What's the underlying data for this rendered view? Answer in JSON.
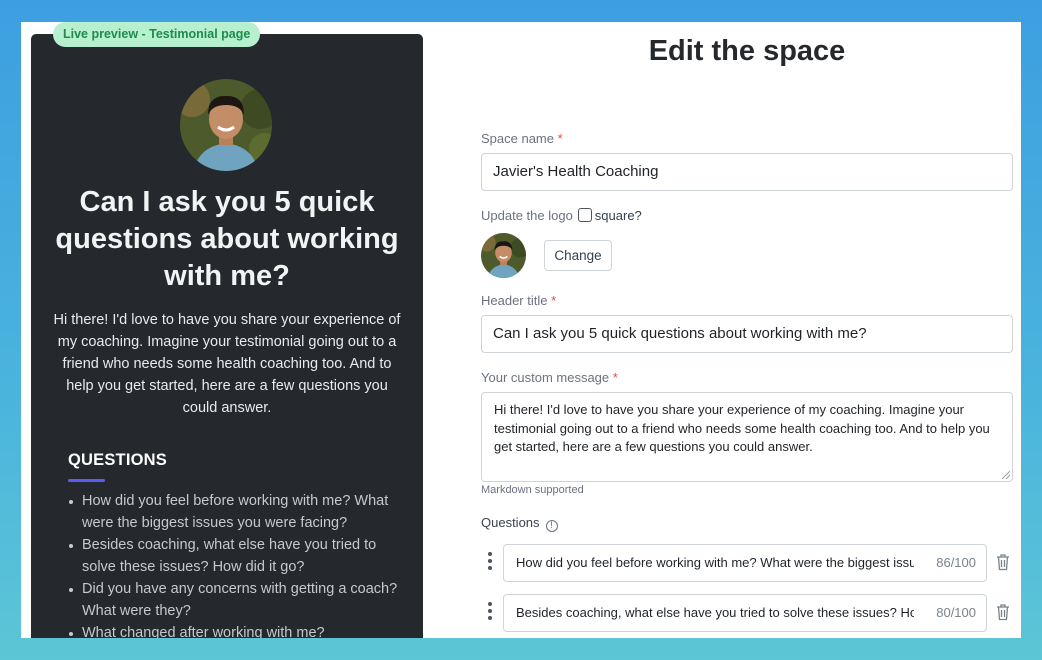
{
  "preview": {
    "badge": "Live preview - Testimonial page",
    "title": "Can I ask you 5 quick questions about working with me?",
    "message": "Hi there! I'd love to have you share your experience of my coaching. Imagine your testimonial going out to a friend who needs some health coaching too. And to help you get started, here are a few questions you could answer.",
    "questions_heading": "QUESTIONS",
    "questions": [
      "How did you feel before working with me? What were the biggest issues you were facing?",
      "Besides coaching, what else have you tried to solve these issues? How did it go?",
      "Did you have any concerns with getting a coach? What were they?",
      "What changed after working with me?"
    ]
  },
  "editor": {
    "title": "Edit the space",
    "space_name_label": "Space name",
    "space_name_value": "Javier's Health Coaching",
    "logo_label": "Update the logo",
    "square_label": "square?",
    "change_button": "Change",
    "header_title_label": "Header title",
    "header_title_value": "Can I ask you 5 quick questions about working with me?",
    "custom_message_label": "Your custom message",
    "custom_message_value": "Hi there! I'd love to have you share your experience of my coaching. Imagine your testimonial going out to a friend who needs some health coaching too. And to help you get started, here are a few questions you could answer.",
    "markdown_hint": "Markdown supported",
    "questions_label": "Questions",
    "required_mark": "*",
    "info_glyph": "!",
    "questions": [
      {
        "text": "How did you feel before working with me? What were the biggest issues you were facing?",
        "count": "86/100"
      },
      {
        "text": "Besides coaching, what else have you tried to solve these issues? How did it go?",
        "count": "80/100"
      }
    ]
  },
  "colors": {
    "preview_bg": "#25282c",
    "badge_bg": "#b7f0cf",
    "badge_text": "#1f8a4c",
    "accent_underline": "#5b5cf0",
    "required": "#e5484d"
  },
  "icons": [
    "avatar-photo",
    "info-icon",
    "drag-handle-icon",
    "trash-icon"
  ]
}
